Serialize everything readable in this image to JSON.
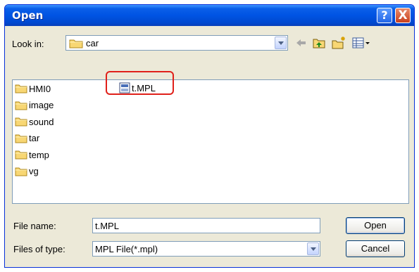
{
  "dialog": {
    "title": "Open"
  },
  "titlebar_buttons": {
    "help": "?",
    "close": "X"
  },
  "look_in": {
    "label": "Look in:",
    "value": "car"
  },
  "toolbar": [
    "back-arrow-icon",
    "up-folder-icon",
    "new-folder-icon",
    "views-menu-icon"
  ],
  "files": [
    {
      "name": "HMI0",
      "type": "folder"
    },
    {
      "name": "image",
      "type": "folder"
    },
    {
      "name": "sound",
      "type": "folder"
    },
    {
      "name": "tar",
      "type": "folder"
    },
    {
      "name": "temp",
      "type": "folder"
    },
    {
      "name": "vg",
      "type": "folder"
    },
    {
      "name": "t.MPL",
      "type": "mpl-file",
      "highlighted": true
    }
  ],
  "file_name": {
    "label": "File name:",
    "value": "t.MPL"
  },
  "file_type": {
    "label": "Files of type:",
    "value": "MPL File(*.mpl)"
  },
  "buttons": {
    "open": "Open",
    "cancel": "Cancel"
  },
  "colors": {
    "titlebar": "#0054e3",
    "dialog_bg": "#ece9d8",
    "highlight": "#e0201a"
  }
}
